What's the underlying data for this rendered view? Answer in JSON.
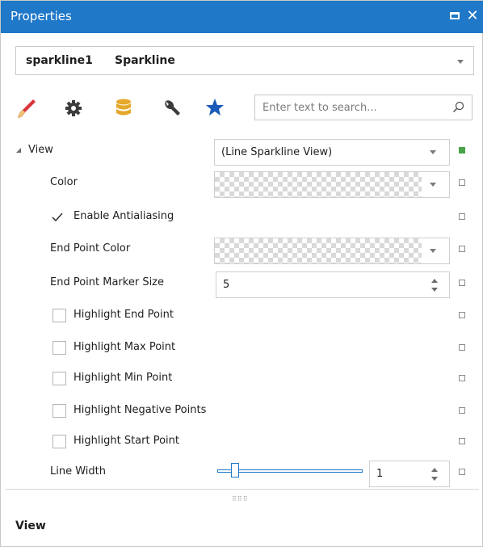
{
  "window": {
    "title": "Properties"
  },
  "object_selector": {
    "name": "sparkline1",
    "type": "Sparkline"
  },
  "toolbar": {
    "icons": [
      "brush-icon",
      "gear-icon",
      "database-icon",
      "wrench-icon",
      "star-icon"
    ],
    "search_placeholder": "Enter text to search..."
  },
  "properties": {
    "view": {
      "label": "View",
      "value": "(Line Sparkline View)"
    },
    "color": {
      "label": "Color"
    },
    "antialiasing": {
      "label": "Enable Antialiasing",
      "checked": true
    },
    "end_point_color": {
      "label": "End Point Color"
    },
    "end_point_marker_size": {
      "label": "End Point Marker Size",
      "value": "5"
    },
    "highlight_end": {
      "label": "Highlight End Point",
      "checked": false
    },
    "highlight_max": {
      "label": "Highlight Max Point",
      "checked": false
    },
    "highlight_min": {
      "label": "Highlight Min Point",
      "checked": false
    },
    "highlight_negative": {
      "label": "Highlight Negative Points",
      "checked": false
    },
    "highlight_start": {
      "label": "Highlight Start Point",
      "checked": false
    },
    "line_width": {
      "label": "Line Width",
      "value": "1",
      "slider_fraction": 0.1
    }
  },
  "description": {
    "title": "View"
  },
  "colors": {
    "accent": "#1f78c8",
    "titlebar": "#1f78c8",
    "brush_red": "#d9363a",
    "database_gold": "#e4a82b",
    "star_blue": "#1a5ab8",
    "state_set": "#48a348"
  }
}
